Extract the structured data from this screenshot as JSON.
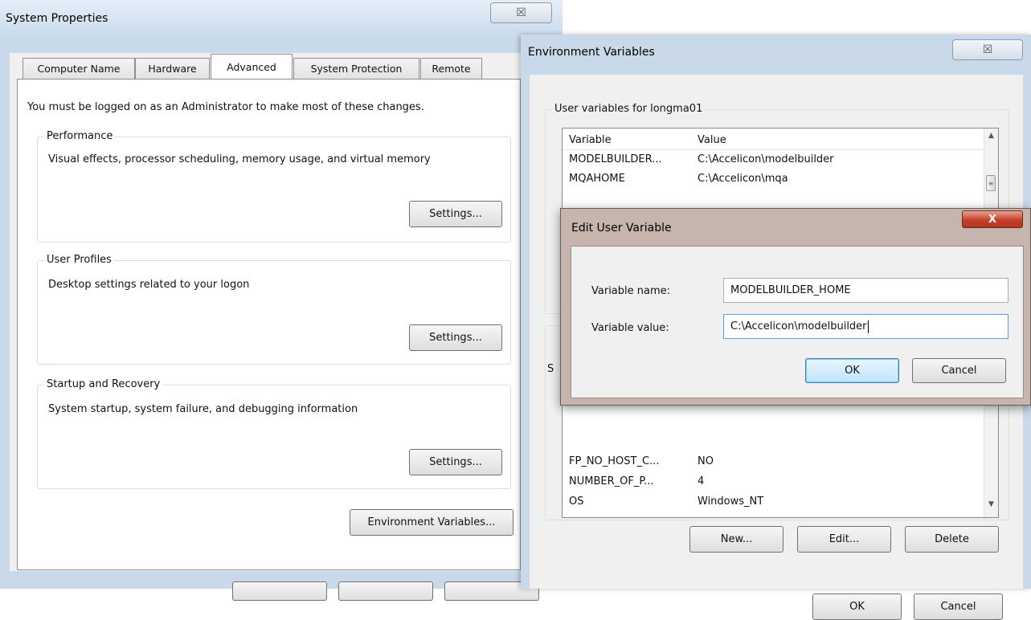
{
  "system_properties": {
    "title": "System Properties",
    "close_glyph": "☒",
    "tabs": [
      {
        "label": "Computer Name"
      },
      {
        "label": "Hardware"
      },
      {
        "label": "Advanced"
      },
      {
        "label": "System Protection"
      },
      {
        "label": "Remote"
      }
    ],
    "active_tab": "Advanced",
    "admin_notice": "You must be logged on as an Administrator to make most of these changes.",
    "groups": {
      "performance": {
        "title": "Performance",
        "description": "Visual effects, processor scheduling, memory usage, and virtual memory",
        "button": "Settings..."
      },
      "user_profiles": {
        "title": "User Profiles",
        "description": "Desktop settings related to your logon",
        "button": "Settings..."
      },
      "startup_recovery": {
        "title": "Startup and Recovery",
        "description": "System startup, system failure, and debugging information",
        "button": "Settings..."
      }
    },
    "env_vars_button": "Environment Variables..."
  },
  "environment_variables": {
    "title": "Environment Variables",
    "close_glyph": "☒",
    "user_group_title": "User variables for longma01",
    "columns": {
      "variable": "Variable",
      "value": "Value"
    },
    "user_rows": [
      {
        "variable": "MODELBUILDER...",
        "value": "C:\\Accelicon\\modelbuilder"
      },
      {
        "variable": "MQAHOME",
        "value": "C:\\Accelicon\\mqa"
      }
    ],
    "system_group_initial": "S",
    "system_rows": [
      {
        "variable": "FP_NO_HOST_C...",
        "value": "NO"
      },
      {
        "variable": "NUMBER_OF_P...",
        "value": "4"
      },
      {
        "variable": "OS",
        "value": "Windows_NT"
      }
    ],
    "buttons": {
      "new": "New...",
      "edit": "Edit...",
      "delete": "Delete",
      "ok": "OK",
      "cancel": "Cancel"
    },
    "scroll_up_glyph": "▲",
    "scroll_down_glyph": "▼",
    "scroll_thumb_glyph": "≡"
  },
  "edit_user_variable": {
    "title": "Edit User Variable",
    "close_glyph": "X",
    "name_label": "Variable name:",
    "name_value": "MODELBUILDER_HOME",
    "value_label": "Variable value:",
    "value_value": "C:\\Accelicon\\modelbuilder",
    "ok": "OK",
    "cancel": "Cancel"
  }
}
